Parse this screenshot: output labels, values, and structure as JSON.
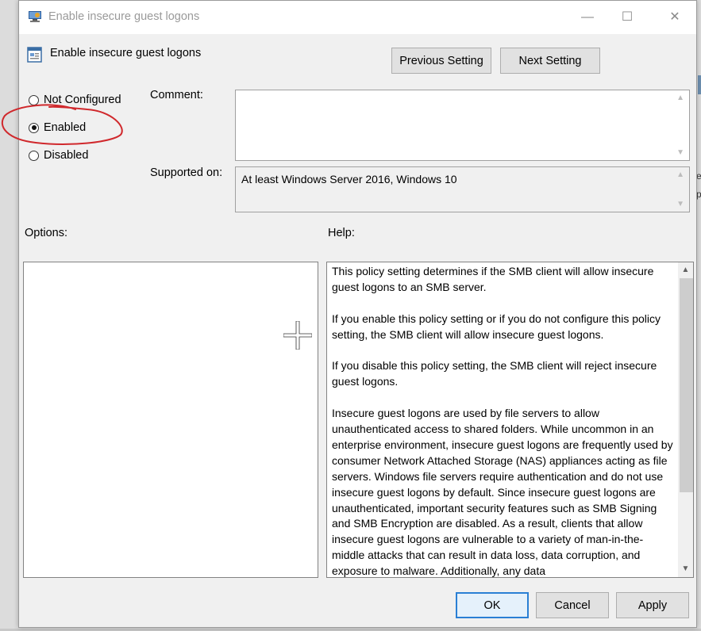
{
  "window": {
    "title": "Enable insecure guest logons",
    "controls": {
      "minimize": "—",
      "maximize": "☐",
      "close": "✕"
    }
  },
  "policy": {
    "name": "Enable insecure guest logons"
  },
  "nav": {
    "previous_label": "Previous Setting",
    "next_label": "Next Setting"
  },
  "state": {
    "options": [
      {
        "label": "Not Configured",
        "selected": false
      },
      {
        "label": "Enabled",
        "selected": true
      },
      {
        "label": "Disabled",
        "selected": false
      }
    ]
  },
  "comment": {
    "label": "Comment:",
    "value": ""
  },
  "supported": {
    "label": "Supported on:",
    "value": "At least Windows Server 2016, Windows 10"
  },
  "options_panel": {
    "label": "Options:"
  },
  "help_panel": {
    "label": "Help:",
    "paragraphs": [
      "This policy setting determines if the SMB client will allow insecure guest logons to an SMB server.",
      "If you enable this policy setting or if you do not configure this policy setting, the SMB client will allow insecure guest logons.",
      "If you disable this policy setting, the SMB client will reject insecure guest logons.",
      "Insecure guest logons are used by file servers to allow unauthenticated access to shared folders. While uncommon in an enterprise environment, insecure guest logons are frequently used by consumer Network Attached Storage (NAS) appliances acting as file servers. Windows file servers require authentication and do not use insecure guest logons by default. Since insecure guest logons are unauthenticated, important security features such as SMB Signing and SMB Encryption are disabled. As a result, clients that allow insecure guest logons are vulnerable to a variety of man-in-the-middle attacks that can result in data loss, data corruption, and exposure to malware. Additionally, any data"
    ]
  },
  "footer": {
    "ok_label": "OK",
    "cancel_label": "Cancel",
    "apply_label": "Apply"
  },
  "background_glyphs": [
    "e",
    "p"
  ],
  "colors": {
    "annotation": "#d0282c",
    "ok_border": "#2a7fd4"
  }
}
